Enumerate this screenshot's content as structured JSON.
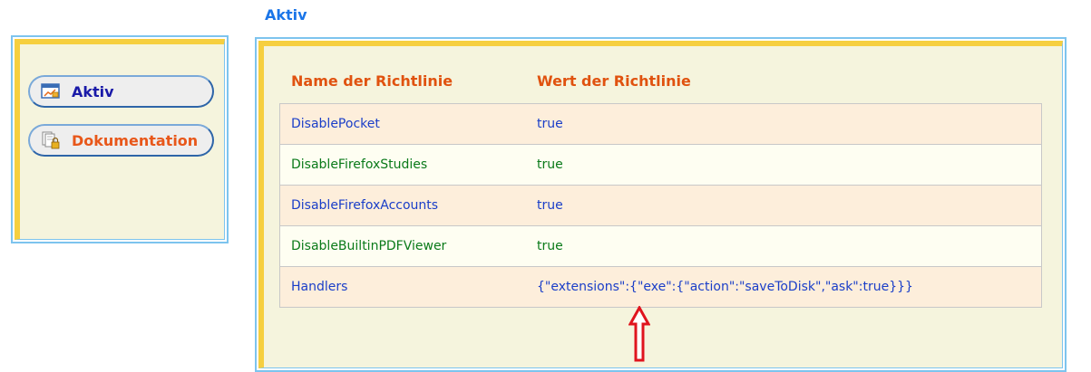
{
  "page": {
    "title": "Aktiv"
  },
  "sidebar": {
    "items": [
      {
        "label": "Aktiv",
        "icon": "window-chart-icon"
      },
      {
        "label": "Dokumentation",
        "icon": "locked-documents-icon"
      }
    ]
  },
  "table": {
    "headers": {
      "name": "Name der Richtlinie",
      "value": "Wert der Richtlinie"
    },
    "rows": [
      {
        "name": "DisablePocket",
        "value": "true"
      },
      {
        "name": "DisableFirefoxStudies",
        "value": "true"
      },
      {
        "name": "DisableFirefoxAccounts",
        "value": "true"
      },
      {
        "name": "DisableBuiltinPDFViewer",
        "value": "true"
      },
      {
        "name": "Handlers",
        "value": "{\"extensions\":{\"exe\":{\"action\":\"saveToDisk\",\"ask\":true}}}"
      }
    ]
  },
  "annotation": {
    "icon": "red-up-arrow-icon",
    "color": "#e0141e"
  },
  "colors": {
    "title": "#1a75e8",
    "header": "#e0520f",
    "row_blue": "#1a3ec8",
    "row_green": "#0a7a1a",
    "accent_yellow": "#f6cf3f",
    "frame_blue": "#7dc4ee"
  }
}
